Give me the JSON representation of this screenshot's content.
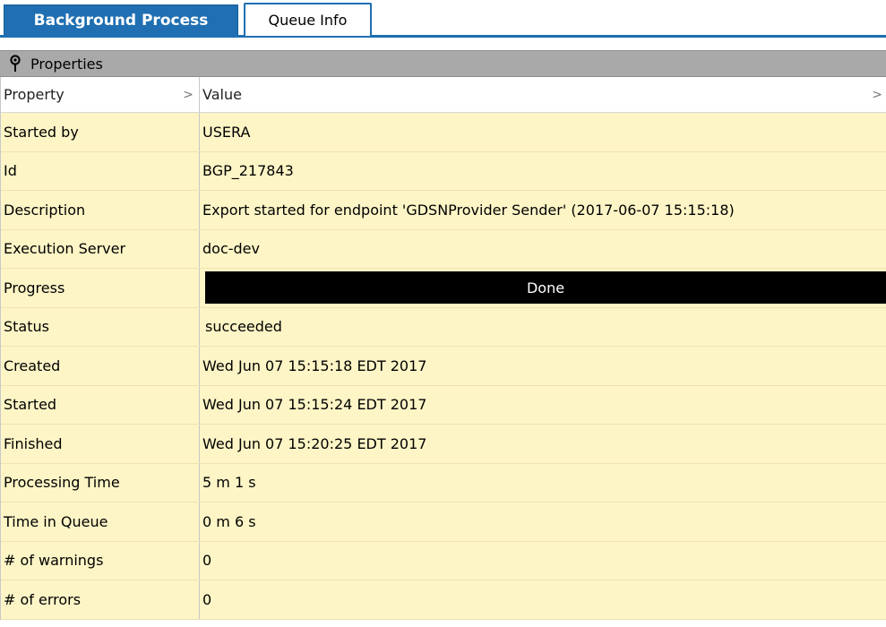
{
  "tabs": [
    {
      "label": "Background Process",
      "active": true
    },
    {
      "label": "Queue Info",
      "active": false
    }
  ],
  "panel": {
    "title": "Properties",
    "icon": "pin-icon"
  },
  "columns": {
    "property": "Property",
    "value": "Value",
    "sort_indicator": ">"
  },
  "rows": {
    "started_by": {
      "label": "Started by",
      "value": "USERA"
    },
    "id": {
      "label": "Id",
      "value": "BGP_217843"
    },
    "description": {
      "label": "Description",
      "value": "Export started for endpoint 'GDSNProvider Sender' (2017-06-07 15:15:18)"
    },
    "execution_server": {
      "label": "Execution Server",
      "value": "doc-dev"
    },
    "progress": {
      "label": "Progress",
      "value": "Done",
      "percent": 100
    },
    "status": {
      "label": "Status",
      "value": "succeeded"
    },
    "created": {
      "label": "Created",
      "value": "Wed Jun 07 15:15:18 EDT 2017"
    },
    "started": {
      "label": "Started",
      "value": "Wed Jun 07 15:15:24 EDT 2017"
    },
    "finished": {
      "label": "Finished",
      "value": "Wed Jun 07 15:20:25 EDT 2017"
    },
    "processing_time": {
      "label": "Processing Time",
      "value": "5 m 1 s"
    },
    "time_in_queue": {
      "label": "Time in Queue",
      "value": "0 m 6 s"
    },
    "warnings": {
      "label": "# of warnings",
      "value": "0"
    },
    "errors": {
      "label": "# of errors",
      "value": "0"
    }
  },
  "colors": {
    "tab_accent": "#1f6fb2",
    "row_background": "#fdf5c6",
    "panel_header": "#a9a9a9",
    "progress_fill": "#000000"
  }
}
